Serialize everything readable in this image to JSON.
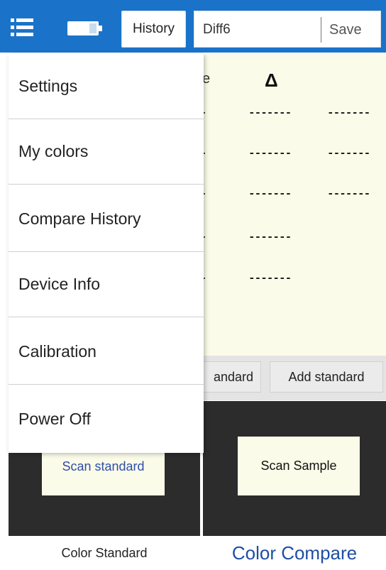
{
  "header": {
    "history_label": "History",
    "diff_value": "Diff6",
    "save_label": "Save",
    "icons": {
      "menu": "hamburger-menu-icon",
      "battery": "battery-icon"
    },
    "colors": {
      "bar": "#1a73c9"
    }
  },
  "results": {
    "partial_header": "e",
    "delta_header": "Δ",
    "placeholders": [
      [
        "-------",
        "-------"
      ],
      [
        "-------",
        "-------"
      ],
      [
        "-------",
        "-------"
      ],
      [
        "-------"
      ],
      [
        "-------"
      ]
    ]
  },
  "standard_actions": {
    "partial_button": "andard",
    "add_standard": "Add standard"
  },
  "scan": {
    "scan_standard": "Scan standard",
    "scan_sample": "Scan Sample"
  },
  "tabs": {
    "color_standard": "Color Standard",
    "color_compare": "Color Compare"
  },
  "menu": {
    "items": [
      {
        "label": "Settings"
      },
      {
        "label": "My colors"
      },
      {
        "label": "Compare History"
      },
      {
        "label": "Device Info"
      },
      {
        "label": "Calibration"
      },
      {
        "label": "Power Off"
      }
    ]
  }
}
